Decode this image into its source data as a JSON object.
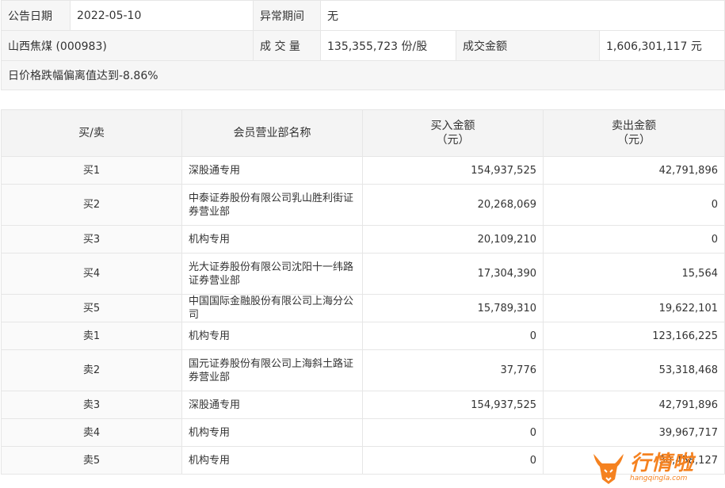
{
  "info": {
    "date_label": "公告日期",
    "date_value": "2022-05-10",
    "period_label": "异常期间",
    "period_value": "无",
    "stock": "山西焦煤 (000983)",
    "volume_label": "成 交 量",
    "volume_value": "135,355,723 份/股",
    "amount_label": "成交金额",
    "amount_value": "1,606,301,117 元",
    "reason": "日价格跌幅偏离值达到-8.86%"
  },
  "table": {
    "headers": {
      "side": "买/卖",
      "member": "会员营业部名称",
      "buy_line1": "买入金额",
      "buy_line2": "（元）",
      "sell_line1": "卖出金额",
      "sell_line2": "（元）"
    },
    "rows": [
      {
        "side": "买1",
        "name": "深股通专用",
        "buy": "154,937,525",
        "sell": "42,791,896"
      },
      {
        "side": "买2",
        "name": "中泰证券股份有限公司乳山胜利街证券营业部",
        "buy": "20,268,069",
        "sell": "0"
      },
      {
        "side": "买3",
        "name": "机构专用",
        "buy": "20,109,210",
        "sell": "0"
      },
      {
        "side": "买4",
        "name": "光大证券股份有限公司沈阳十一纬路证券营业部",
        "buy": "17,304,390",
        "sell": "15,564"
      },
      {
        "side": "买5",
        "name": "中国国际金融股份有限公司上海分公司",
        "buy": "15,789,310",
        "sell": "19,622,101"
      },
      {
        "side": "卖1",
        "name": "机构专用",
        "buy": "0",
        "sell": "123,166,225"
      },
      {
        "side": "卖2",
        "name": "国元证券股份有限公司上海斜土路证券营业部",
        "buy": "37,776",
        "sell": "53,318,468"
      },
      {
        "side": "卖3",
        "name": "深股通专用",
        "buy": "154,937,525",
        "sell": "42,791,896"
      },
      {
        "side": "卖4",
        "name": "机构专用",
        "buy": "0",
        "sell": "39,967,717"
      },
      {
        "side": "卖5",
        "name": "机构专用",
        "buy": "0",
        "sell": "30,458,127"
      }
    ]
  },
  "watermark": {
    "logo_icon": "bull-head-icon",
    "brand_text": "行情啦",
    "url_text": "hangqingla.com",
    "color": "#f58220"
  }
}
